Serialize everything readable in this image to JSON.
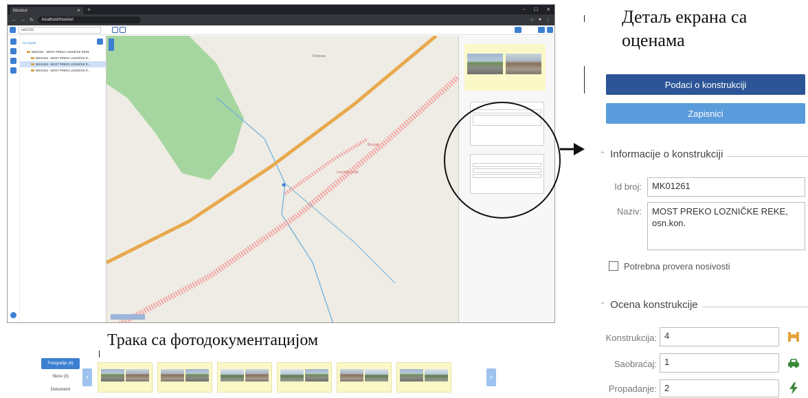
{
  "captions": {
    "detail_title": "Детаљ екрана са оценама",
    "strip_title": "Трака са фотодокументацијом"
  },
  "browser": {
    "tab_title": "Mostovi",
    "address": "localhost/mostovi",
    "search_value": "mk0126"
  },
  "tree": {
    "head": "Svi objekti",
    "items": [
      "MK01261 - MOST PREKO LOZNIČKE REKE",
      "MK01262 - MOST PREKO LOZNIČKE R...",
      "MK01263 - MOST PREKO LOZNIČKE R...",
      "MK01264 - MOST PREKO LOZNIČKE R..."
    ]
  },
  "map": {
    "labels": [
      "Ristovac",
      "Lozničko polje",
      "Brezjak"
    ]
  },
  "detail": {
    "btn_construction": "Podaci o konstrukciji",
    "btn_records": "Zapisnici",
    "info_section": "Informacije o konstrukciji",
    "id_label": "Id broj:",
    "id_value": "MK01261",
    "name_label": "Naziv:",
    "name_value": "MOST PREKO LOZNIČKE REKE, osn.kon.",
    "check_label": "Potrebna provera nosivosti",
    "rating_section": "Ocena konstrukcije",
    "ratings": [
      {
        "label": "Konstrukcija:",
        "value": "4",
        "icon": "bridge-icon",
        "color": "#e6a23c"
      },
      {
        "label": "Saobraćaj:",
        "value": "1",
        "icon": "car-icon",
        "color": "#3c8a3c"
      },
      {
        "label": "Propadanje:",
        "value": "2",
        "icon": "lightning-icon",
        "color": "#3c8a3c"
      }
    ]
  },
  "strip": {
    "tabs": [
      "Fotografije (6)",
      "Skice (3)",
      "Dokumenti"
    ],
    "item_count": 6
  },
  "colors": {
    "primary": "#2c5597",
    "secondary": "#5a9bdb",
    "highway": "#e8a94d",
    "river": "#6fb0dd",
    "forest": "#a6d6a0"
  }
}
